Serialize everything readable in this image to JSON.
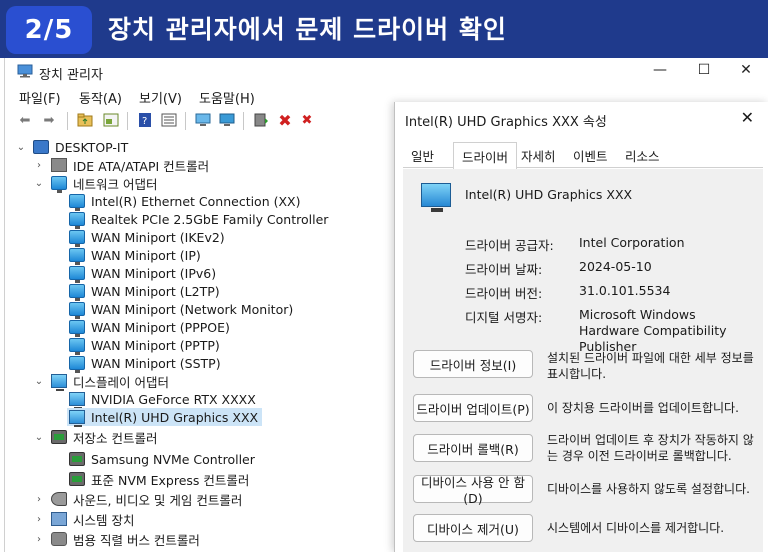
{
  "banner": {
    "step": "2/5",
    "title": "장치 관리자에서 문제 드라이버 확인"
  },
  "window": {
    "title": "장치 관리자",
    "controls": {
      "minimize": "—",
      "maximize": "☐",
      "close": "✕"
    }
  },
  "menu": [
    "파일(F)",
    "동작(A)",
    "보기(V)",
    "도움말(H)"
  ],
  "tree": {
    "root": "DESKTOP-IT",
    "items": [
      {
        "label": "IDE ATA/ATAPI 컨트롤러",
        "icon": "ide-controller-icon",
        "level": 1,
        "expanded": false
      },
      {
        "label": "네트워크 어댑터",
        "icon": "network-adapter-icon",
        "level": 1,
        "expanded": true
      },
      {
        "label": "Intel(R) Ethernet Connection (XX)",
        "icon": "network-adapter-icon",
        "level": 2
      },
      {
        "label": "Realtek PCIe 2.5GbE Family Controller",
        "icon": "network-adapter-icon",
        "level": 2
      },
      {
        "label": "WAN Miniport (IKEv2)",
        "icon": "network-adapter-icon",
        "level": 2
      },
      {
        "label": "WAN Miniport (IP)",
        "icon": "network-adapter-icon",
        "level": 2
      },
      {
        "label": "WAN Miniport (IPv6)",
        "icon": "network-adapter-icon",
        "level": 2
      },
      {
        "label": "WAN Miniport (L2TP)",
        "icon": "network-adapter-icon",
        "level": 2
      },
      {
        "label": "WAN Miniport (Network Monitor)",
        "icon": "network-adapter-icon",
        "level": 2
      },
      {
        "label": "WAN Miniport (PPPOE)",
        "icon": "network-adapter-icon",
        "level": 2
      },
      {
        "label": "WAN Miniport (PPTP)",
        "icon": "network-adapter-icon",
        "level": 2
      },
      {
        "label": "WAN Miniport (SSTP)",
        "icon": "network-adapter-icon",
        "level": 2
      },
      {
        "label": "디스플레이 어댑터",
        "icon": "display-adapter-icon",
        "level": 1,
        "expanded": true
      },
      {
        "label": "NVIDIA GeForce RTX XXXX",
        "icon": "display-adapter-icon",
        "level": 2
      },
      {
        "label": "Intel(R) UHD Graphics XXX",
        "icon": "display-adapter-icon",
        "level": 2,
        "selected": true
      },
      {
        "label": "저장소 컨트롤러",
        "icon": "storage-controller-icon",
        "level": 1,
        "expanded": true
      },
      {
        "label": "Samsung NVMe Controller",
        "icon": "storage-controller-icon",
        "level": 2
      },
      {
        "label": "표준 NVM Express 컨트롤러",
        "icon": "storage-controller-icon",
        "level": 2
      },
      {
        "label": "사운드, 비디오 및 게임 컨트롤러",
        "icon": "sound-icon",
        "level": 1,
        "expanded": false
      },
      {
        "label": "시스템 장치",
        "icon": "system-device-icon",
        "level": 1,
        "expanded": false
      },
      {
        "label": "범용 직렬 버스 컨트롤러",
        "icon": "usb-controller-icon",
        "level": 1,
        "expanded": false
      }
    ]
  },
  "dialog": {
    "title": "Intel(R) UHD Graphics XXX 속성",
    "close": "✕",
    "tabs": [
      "일반",
      "드라이버",
      "자세히",
      "이벤트",
      "리소스"
    ],
    "active_tab": "드라이버",
    "device_name": "Intel(R) UHD Graphics XXX",
    "props": {
      "provider_label": "드라이버 공급자:",
      "provider_value": "Intel Corporation",
      "date_label": "드라이버 날짜:",
      "date_value": "2024-05-10",
      "version_label": "드라이버 버전:",
      "version_value": "31.0.101.5534",
      "signer_label": "디지털 서명자:",
      "signer_value": "Microsoft Windows Hardware Compatibility Publisher"
    },
    "buttons": [
      {
        "label": "드라이버 정보(I)",
        "desc": "설치된 드라이버 파일에 대한 세부 정보를 표시합니다."
      },
      {
        "label": "드라이버 업데이트(P)",
        "desc": "이 장치용 드라이버를 업데이트합니다."
      },
      {
        "label": "드라이버 롤백(R)",
        "desc": "드라이버 업데이트 후 장치가 작동하지 않는 경우 이전 드라이버로 롤백합니다."
      },
      {
        "label": "디바이스 사용 안 함(D)",
        "desc": "디바이스를 사용하지 않도록 설정합니다."
      },
      {
        "label": "디바이스 제거(U)",
        "desc": "시스템에서 디바이스를 제거합니다."
      }
    ]
  },
  "colors": {
    "banner": "#1f3a8c",
    "badge": "#2a4fd1",
    "selection": "#cce4f7"
  }
}
